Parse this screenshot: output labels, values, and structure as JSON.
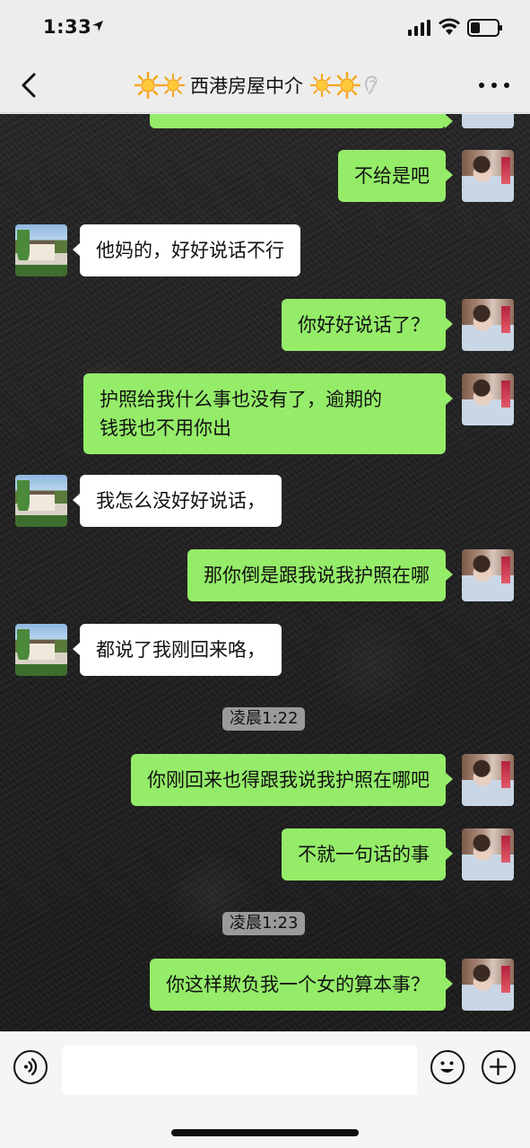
{
  "status_bar": {
    "time": "1:33"
  },
  "header": {
    "title": "西港房屋中介",
    "back_icon": "chevron-left-icon",
    "more_icon": "more-dots-icon"
  },
  "messages": [
    {
      "side": "me",
      "text": "不给是吧"
    },
    {
      "side": "them",
      "text": "他妈的，好好说话不行"
    },
    {
      "side": "me",
      "text": "你好好说话了？"
    },
    {
      "side": "me",
      "line1": "护照给我什么事也没有了，逾期的",
      "line2": "钱我也不用你出"
    },
    {
      "side": "them",
      "text": "我怎么没好好说话，"
    },
    {
      "side": "me",
      "text": "那你倒是跟我说我护照在哪"
    },
    {
      "side": "them",
      "text": "都说了我刚回来咯，"
    },
    {
      "side": "me",
      "text": "你刚回来也得跟我说我护照在哪吧"
    },
    {
      "side": "me",
      "text": "不就一句话的事"
    },
    {
      "side": "me",
      "text": "你这样欺负我一个女的算本事？"
    }
  ],
  "timestamps": [
    "凌晨1:22",
    "凌晨1:23"
  ],
  "input_bar": {
    "text_value": ""
  }
}
